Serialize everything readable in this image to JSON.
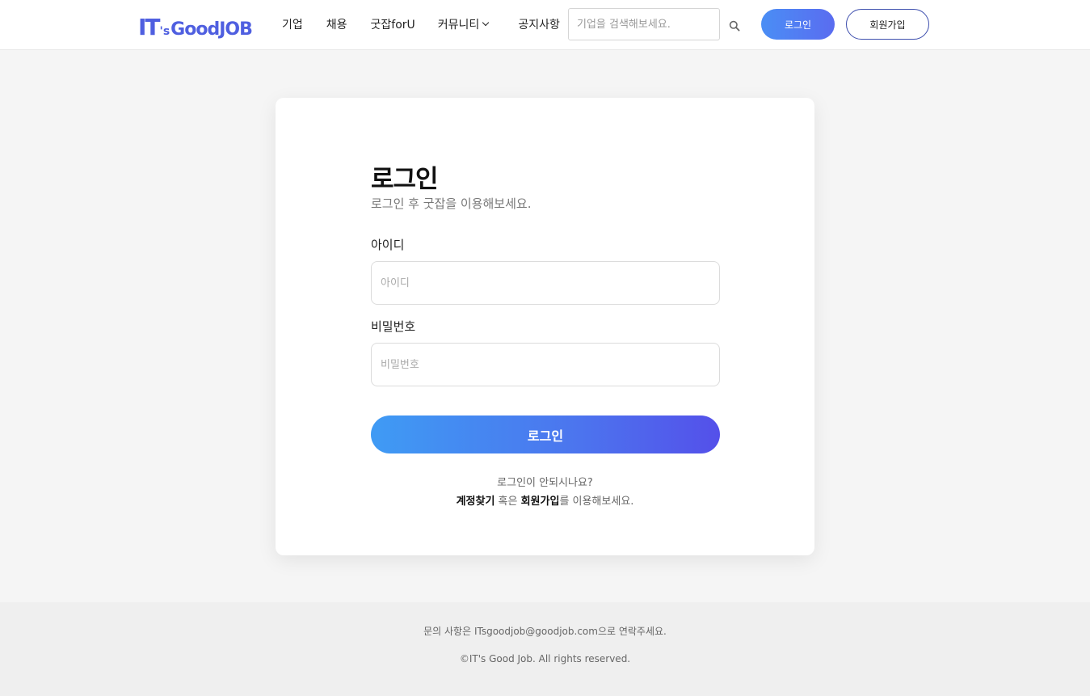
{
  "header": {
    "logo": {
      "part1": "IT",
      "part2": "'s",
      "part3": "GoodJOB"
    },
    "nav": [
      {
        "label": "기업"
      },
      {
        "label": "채용"
      },
      {
        "label": "굿잡forU"
      },
      {
        "label": "커뮤니티"
      },
      {
        "label": "공지사항"
      }
    ],
    "search": {
      "placeholder": "기업을 검색해보세요.",
      "value": ""
    },
    "login_label": "로그인",
    "signup_label": "회원가입"
  },
  "login": {
    "title": "로그인",
    "subtitle": "로그인 후 굿잡을 이용해보세요.",
    "id": {
      "label": "아이디",
      "placeholder": "아이디",
      "value": ""
    },
    "password": {
      "label": "비밀번호",
      "placeholder": "비밀번호",
      "value": ""
    },
    "submit_label": "로그인",
    "help": {
      "question": "로그인이 안되시나요?",
      "find_account": "계정찾기",
      "or_text": " 혹은 ",
      "signup": "회원가입",
      "suffix": "를 이용해보세요."
    }
  },
  "footer": {
    "contact": "문의 사항은 ITsgoodjob@goodjob.com으로 연락주세요.",
    "copyright": "©IT's Good Job. All rights reserved."
  },
  "colors": {
    "brand": "#4f5fe0",
    "button_gradient_start": "#3f9bf4",
    "button_gradient_end": "#5450ea",
    "signup_border": "#3e4fae",
    "top_accent": "#d9262a"
  }
}
